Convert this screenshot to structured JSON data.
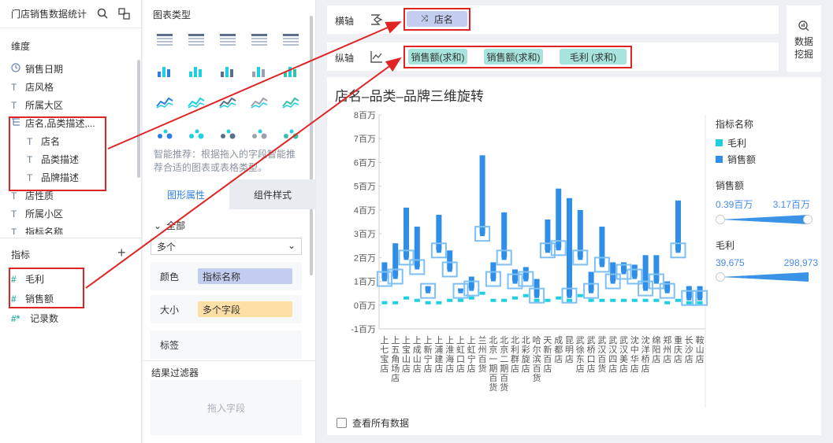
{
  "left": {
    "title": "门店销售数据统计",
    "dimension_title": "维度",
    "dimensions": [
      {
        "label": "销售日期",
        "kind": "date"
      },
      {
        "label": "店风格",
        "kind": "text"
      },
      {
        "label": "所属大区",
        "kind": "text"
      },
      {
        "label": "店名,品类描述,...",
        "kind": "hier"
      },
      {
        "label": "店名",
        "kind": "text",
        "indent": true
      },
      {
        "label": "品类描述",
        "kind": "text",
        "indent": true
      },
      {
        "label": "品牌描述",
        "kind": "text",
        "indent": true
      },
      {
        "label": "店性质",
        "kind": "text"
      },
      {
        "label": "所属小区",
        "kind": "text"
      },
      {
        "label": "指标名称",
        "kind": "text"
      }
    ],
    "measure_title": "指标",
    "measures": [
      {
        "label": "毛利"
      },
      {
        "label": "销售额"
      },
      {
        "label": "记录数",
        "star": true
      }
    ]
  },
  "middle": {
    "chart_type_title": "图表类型",
    "recommend_text": "智能推荐：根据拖入的字段智能推荐合适的图表或表格类型。",
    "tab_graph": "图形属性",
    "tab_component": "组件样式",
    "all_label": "全部",
    "select_value": "多个",
    "color_label": "颜色",
    "color_value": "指标名称",
    "size_label": "大小",
    "size_value": "多个字段",
    "label_label": "标签",
    "filter_title": "结果过滤器",
    "filter_placeholder": "拖入字段"
  },
  "axes": {
    "x_label": "横轴",
    "x_field": "店名",
    "y_label": "纵轴",
    "y_fields": [
      "销售额(求和)",
      "销售额(求和)",
      "毛利 (求和)"
    ]
  },
  "mining": {
    "line1": "数据",
    "line2": "挖掘"
  },
  "chart": {
    "title": "店名–品类–品牌三维旋转",
    "show_all": "查看所有数据",
    "legend_title": "指标名称",
    "legend_items": [
      {
        "label": "毛利",
        "color": "#1ed0e0"
      },
      {
        "label": "销售额",
        "color": "#2f8ee8"
      }
    ],
    "sales_title": "销售额",
    "sales_min": "0.39百万",
    "sales_max": "3.17百万",
    "profit_title": "毛利",
    "profit_min": "39,675",
    "profit_max": "298,973"
  },
  "chart_data": {
    "type": "bar",
    "yticks": [
      "8百万",
      "7百万",
      "6百万",
      "5百万",
      "4百万",
      "3百万",
      "2百万",
      "1百万",
      "0百万",
      "-1百万"
    ],
    "ylim": [
      -1,
      8
    ],
    "categories": [
      "上七宝店",
      "上五角场店",
      "上宝山店",
      "上成山店",
      "上新宁店",
      "上浦建店",
      "上淮海店",
      "上虹口店",
      "上虹宁店",
      "兰州百货",
      "北京一期百货",
      "北京二期百货",
      "北利群店",
      "北彩旋店",
      "哈尔滨百货",
      "天新百店",
      "成都店",
      "昆明店",
      "武徐东店",
      "武桥口店",
      "武汉百货",
      "武汉四店",
      "武汉美店",
      "沈中华店",
      "沈洋桥店",
      "绵阳店",
      "郑州店",
      "重庆店",
      "长沙店",
      "鞍山店"
    ],
    "series": [
      {
        "name": "销售额",
        "low": [
          1.1,
          1.2,
          2.0,
          1.6,
          0.6,
          2.3,
          1.5,
          0.6,
          0.7,
          3.0,
          1.1,
          2.0,
          1.0,
          1.1,
          0.4,
          2.3,
          2.4,
          0.4,
          2.0,
          0.6,
          1.7,
          1.0,
          1.4,
          1.2,
          0.7,
          1.0,
          0.6,
          2.3,
          0.3,
          0.3
        ],
        "high": [
          1.8,
          2.6,
          4.1,
          3.3,
          0.8,
          3.8,
          2.3,
          0.7,
          1.2,
          6.3,
          1.8,
          3.9,
          1.5,
          1.6,
          1.1,
          3.6,
          4.9,
          4.5,
          4.0,
          1.4,
          3.3,
          1.8,
          1.8,
          1.7,
          2.1,
          2.1,
          1.0,
          4.4,
          0.8,
          0.8
        ]
      },
      {
        "name": "毛利",
        "values": [
          0.1,
          0.1,
          0.3,
          0.2,
          0.1,
          0.1,
          0.2,
          0.2,
          0.3,
          0.5,
          0.2,
          0.2,
          0.3,
          0.4,
          0.2,
          0.2,
          0.3,
          0.2,
          0.4,
          0.2,
          0.2,
          0.2,
          0.2,
          0.2,
          0.2,
          0.2,
          0.1,
          0.2,
          0.1,
          0.1
        ]
      }
    ]
  }
}
